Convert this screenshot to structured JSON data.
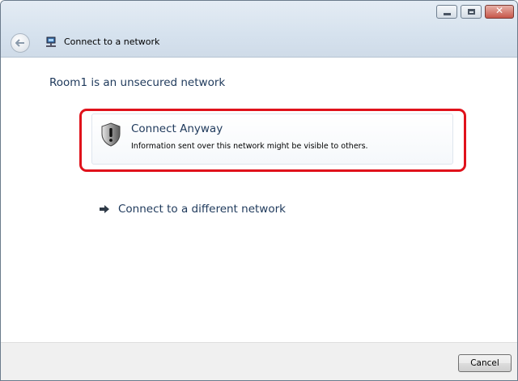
{
  "window": {
    "title": "Connect to a network",
    "controls": {
      "minimize_icon": "minimize-icon",
      "maximize_icon": "maximize-icon",
      "close_glyph": "✕"
    }
  },
  "content": {
    "heading": "Room1 is an unsecured network",
    "primary_option": {
      "icon": "shield-warning-icon",
      "title": "Connect Anyway",
      "description": "Information sent over this network might be visible to others.",
      "highlight_color": "#e0121b"
    },
    "secondary_option": {
      "icon": "arrow-right-icon",
      "label": "Connect to a different network"
    }
  },
  "footer": {
    "cancel_label": "Cancel"
  },
  "colors": {
    "link_text": "#1e395b",
    "titlebar": "#d6e2ee"
  }
}
